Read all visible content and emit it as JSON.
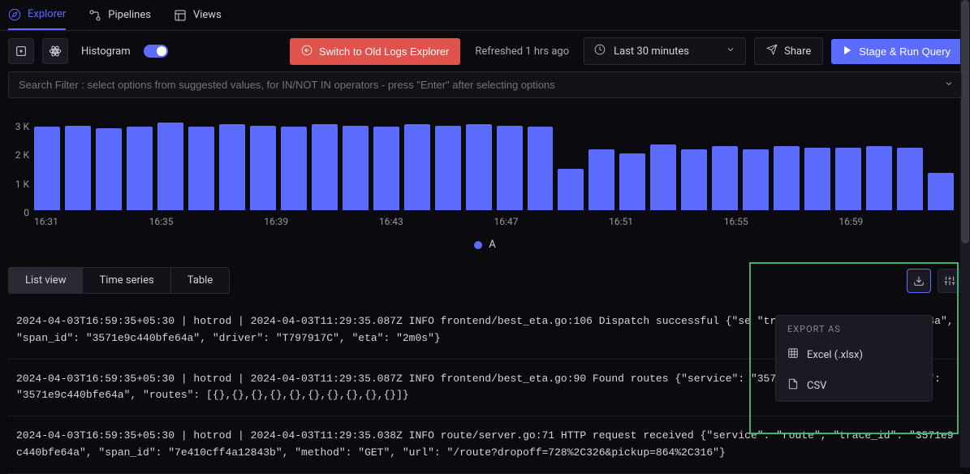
{
  "tabs": {
    "explorer": "Explorer",
    "pipelines": "Pipelines",
    "views": "Views"
  },
  "toolbar": {
    "histogram_label": "Histogram",
    "switch_label": "Switch to Old Logs Explorer",
    "refreshed_label": "Refreshed 1 hrs ago",
    "time_range": "Last 30 minutes",
    "share_label": "Share",
    "run_label": "Stage & Run Query"
  },
  "search": {
    "placeholder": "Search Filter : select options from suggested values, for IN/NOT IN operators - press \"Enter\" after selecting options"
  },
  "chart_data": {
    "type": "bar",
    "y_ticks": [
      "3 K",
      "2 K",
      "1 K",
      "0"
    ],
    "x_ticks": [
      "16:31",
      "16:35",
      "16:39",
      "16:43",
      "16:47",
      "16:51",
      "16:55",
      "16:59"
    ],
    "values": [
      2800,
      2850,
      2750,
      2800,
      2950,
      2800,
      2900,
      2850,
      2800,
      2900,
      2850,
      2800,
      2900,
      2850,
      2900,
      2850,
      2800,
      1400,
      2050,
      1900,
      2200,
      2050,
      2150,
      2050,
      2150,
      2100,
      2100,
      2150,
      2100,
      1250
    ],
    "ylim": [
      0,
      3000
    ],
    "legend": "A"
  },
  "view_tabs": {
    "list": "List view",
    "timeseries": "Time series",
    "table": "Table"
  },
  "export": {
    "header": "EXPORT AS",
    "excel": "Excel (.xlsx)",
    "csv": "CSV"
  },
  "logs": [
    "2024-04-03T16:59:35+05:30 | hotrod | 2024-04-03T11:29:35.087Z INFO frontend/best_eta.go:106 Dispatch successful {\"se\n\"trace_id\": \"3571e9c440bfe64a\", \"span_id\": \"3571e9c440bfe64a\", \"driver\": \"T797917C\", \"eta\": \"2m0s\"}",
    "2024-04-03T16:59:35+05:30 | hotrod | 2024-04-03T11:29:35.087Z INFO frontend/best_eta.go:90 Found routes {\"service\":\n\"3571e9c440bfe64a\", \"span_id\": \"3571e9c440bfe64a\", \"routes\": [{},{},{},{},{},{},{},{},{},{}]}",
    "2024-04-03T16:59:35+05:30 | hotrod | 2024-04-03T11:29:35.038Z INFO route/server.go:71 HTTP request received {\"service\": \"route\", \"trace_id\": \"3571e9c440bfe64a\", \"span_id\": \"7e410cff4a12843b\", \"method\": \"GET\", \"url\": \"/route?dropoff=728%2C326&pickup=864%2C316\"}"
  ]
}
